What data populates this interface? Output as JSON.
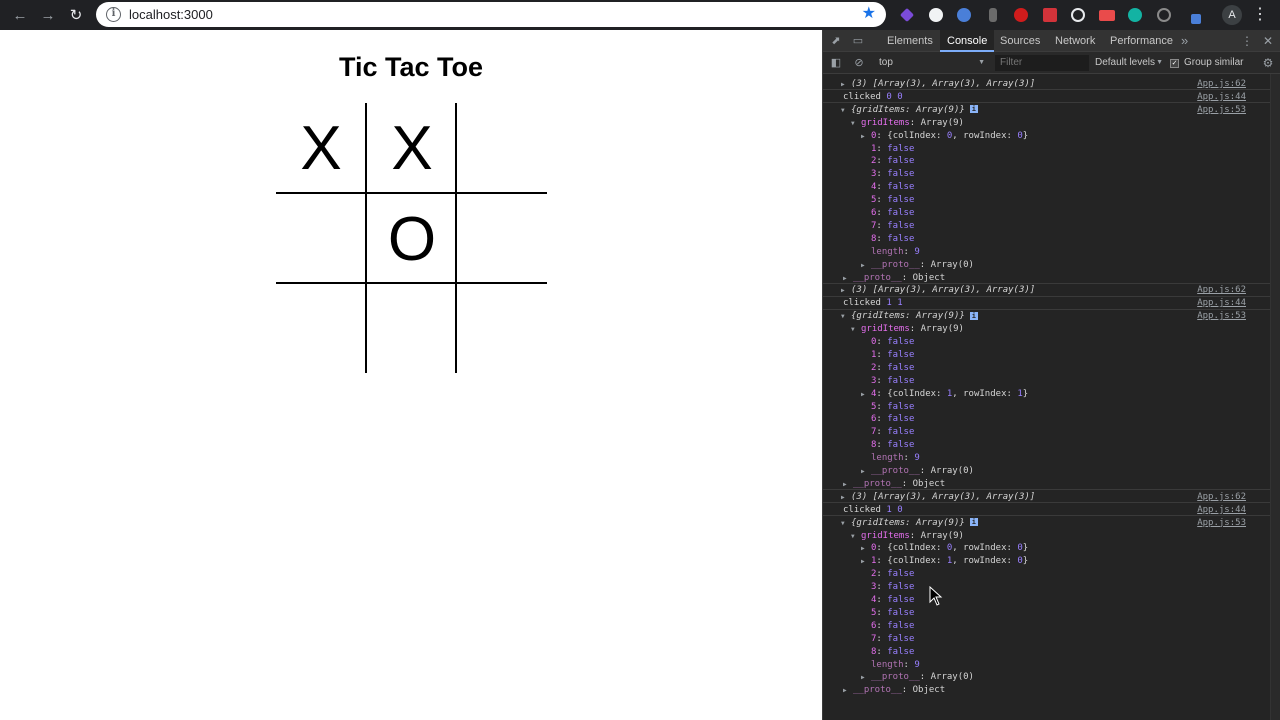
{
  "browser": {
    "url": "localhost:3000",
    "back_icon": "arrow-left-icon",
    "forward_icon": "arrow-right-icon",
    "reload_icon": "reload-icon",
    "star_icon": "star-icon",
    "avatar_letter": "A"
  },
  "app": {
    "title": "Tic Tac Toe",
    "board": [
      [
        "X",
        "X",
        ""
      ],
      [
        "",
        "O",
        ""
      ],
      [
        "",
        "",
        ""
      ]
    ]
  },
  "devtools": {
    "tabs": [
      "Elements",
      "Console",
      "Sources",
      "Network",
      "Performance"
    ],
    "active_tab": "Console",
    "more_tabs": "»",
    "context": "top",
    "filter_placeholder": "Filter",
    "levels": "Default levels",
    "group_similar": "Group similar",
    "console": {
      "array_log": "(3) [Array(3), Array(3), Array(3)]",
      "grid_obj": "{gridItems: Array(9)}",
      "grid_key": "gridItems",
      "grid_val": ": Array(9)",
      "false_val": "false",
      "length_key": "length",
      "length_val": "9",
      "proto_key": "__proto__",
      "proto_array": "Array(0)",
      "proto_obj": "Object",
      "sources": {
        "app62": "App.js:62",
        "app44": "App.js:44",
        "app53": "App.js:53"
      },
      "clicked_label": "clicked",
      "clicked": [
        "0 0",
        "1 1",
        "1 0"
      ],
      "col_key": "colIndex",
      "row_key": "rowIndex"
    }
  }
}
